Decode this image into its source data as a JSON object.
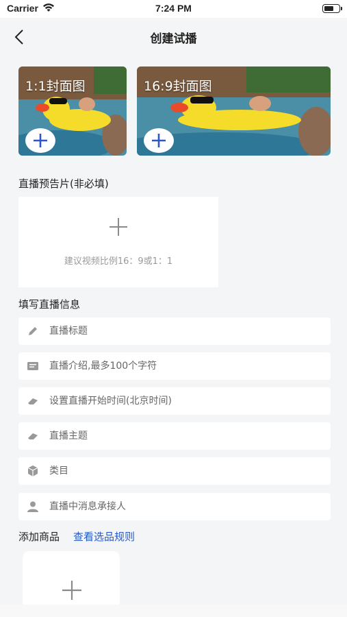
{
  "status_bar": {
    "carrier": "Carrier",
    "time": "7:24 PM"
  },
  "nav": {
    "title": "创建试播"
  },
  "covers": [
    {
      "label": "1:1封面图"
    },
    {
      "label": "16:9封面图"
    }
  ],
  "trailer": {
    "section_title": "直播预告片(非必填)",
    "hint": "建议视频比例16：9或1：1"
  },
  "info": {
    "section_title": "填写直播信息",
    "fields": [
      {
        "placeholder": "直播标题",
        "icon": "pencil-icon"
      },
      {
        "placeholder": "直播介绍,最多100个字符",
        "icon": "description-icon"
      },
      {
        "placeholder": "设置直播开始时间(北京时间)",
        "icon": "eraser-icon"
      },
      {
        "placeholder": "直播主题",
        "icon": "eraser-icon"
      },
      {
        "placeholder": "类目",
        "icon": "box-icon"
      },
      {
        "placeholder": "直播中消息承接人",
        "icon": "person-icon"
      }
    ]
  },
  "goods": {
    "label": "添加商品",
    "rule_link": "查看选品规则"
  },
  "colors": {
    "link": "#2a59c5",
    "plus_blue": "#2d57c4",
    "background": "#f4f5f7"
  }
}
